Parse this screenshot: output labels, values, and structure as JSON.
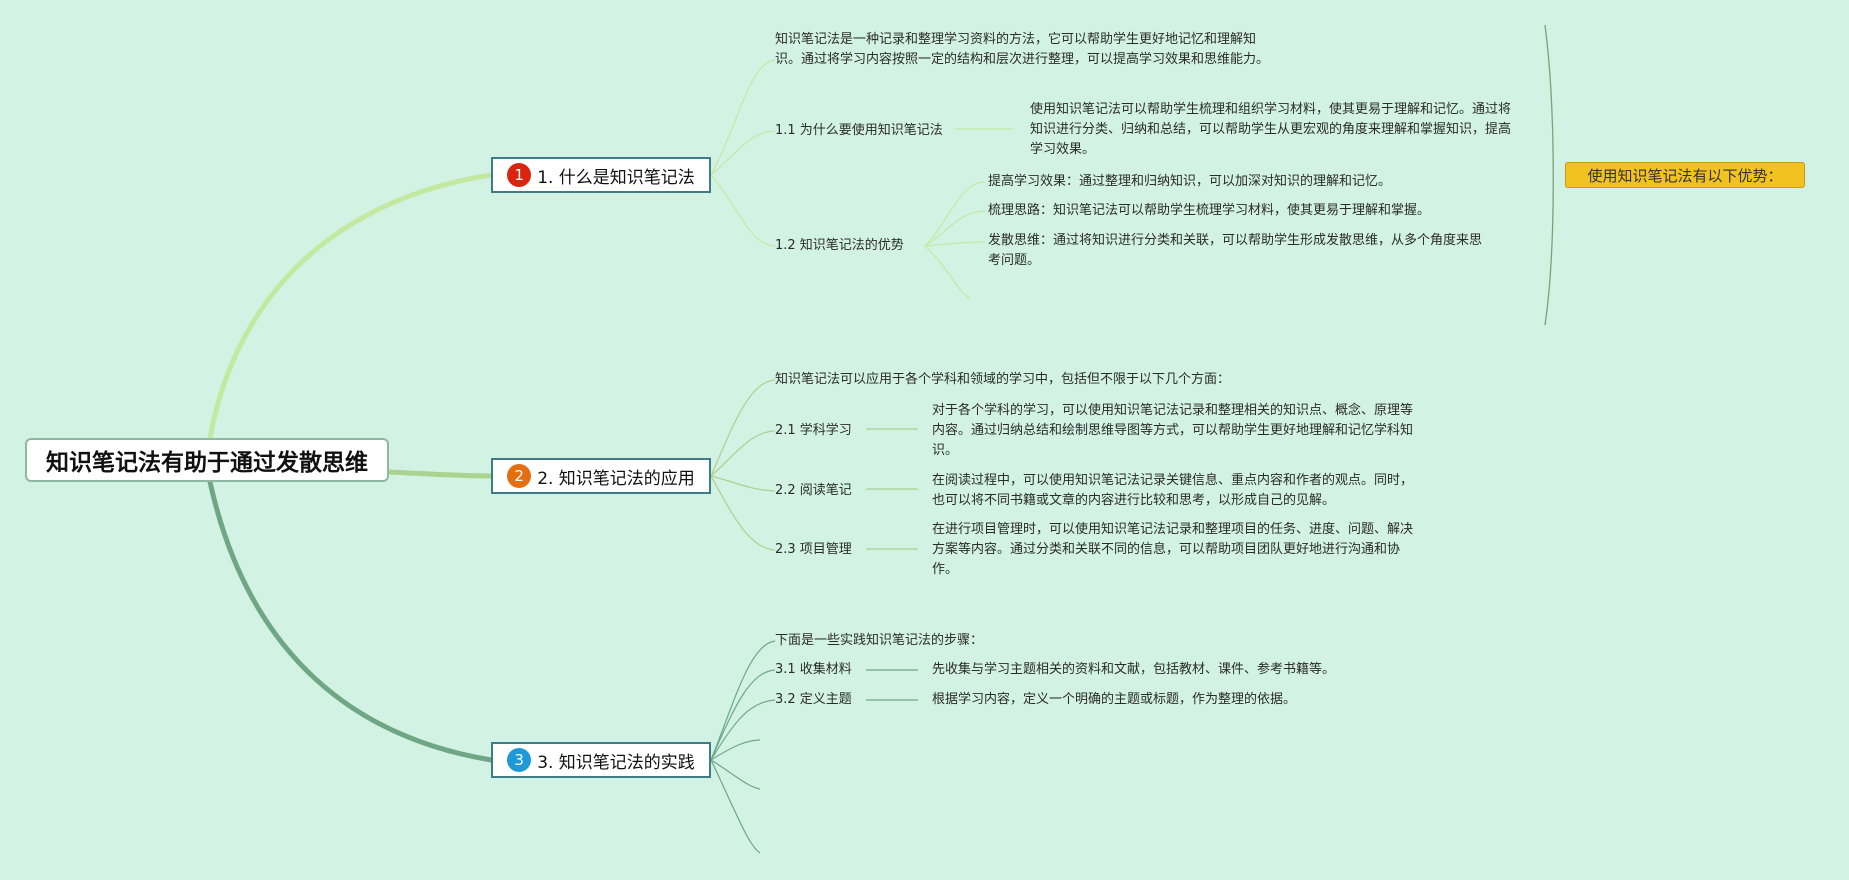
{
  "root": {
    "label": "知识笔记法有助于通过发散思维"
  },
  "colors": {
    "background": "#d2f2e4",
    "branch1": "#c3e9a1",
    "branch2": "#a9d38e",
    "branch3": "#6fa786",
    "badge1": "#d9240f",
    "badge2": "#e46e12",
    "badge3": "#1e9ad9",
    "callout": "#f2c320"
  },
  "sections": [
    {
      "badge": "1",
      "label": "1. 什么是知识笔记法",
      "intro": "知识笔记法是一种记录和整理学习资料的方法，它可以帮助学生更好地记忆和理解知识。通过将学习内容按照一定的结构和层次进行整理，可以提高学习效果和思维能力。",
      "children": [
        {
          "label": "1.1 为什么要使用知识笔记法",
          "detail": "使用知识笔记法可以帮助学生梳理和组织学习材料，使其更易于理解和记忆。通过将知识进行分类、归纳和总结，可以帮助学生从更宏观的角度来理解和掌握知识，提高学习效果。"
        },
        {
          "label": "1.2 知识笔记法的优势",
          "items": [
            "提高学习效果：通过整理和归纳知识，可以加深对知识的理解和记忆。",
            "梳理思路：知识笔记法可以帮助学生梳理学习材料，使其更易于理解和掌握。",
            "发散思维：通过将知识进行分类和关联，可以帮助学生形成发散思维，从多个角度来思考问题。"
          ]
        }
      ]
    },
    {
      "badge": "2",
      "label": "2. 知识笔记法的应用",
      "intro": "知识笔记法可以应用于各个学科和领域的学习中，包括但不限于以下几个方面：",
      "children": [
        {
          "label": "2.1 学科学习",
          "detail": "对于各个学科的学习，可以使用知识笔记法记录和整理相关的知识点、概念、原理等内容。通过归纳总结和绘制思维导图等方式，可以帮助学生更好地理解和记忆学科知识。"
        },
        {
          "label": "2.2 阅读笔记",
          "detail": "在阅读过程中，可以使用知识笔记法记录关键信息、重点内容和作者的观点。同时，也可以将不同书籍或文章的内容进行比较和思考，以形成自己的见解。"
        },
        {
          "label": "2.3 项目管理",
          "detail": "在进行项目管理时，可以使用知识笔记法记录和整理项目的任务、进度、问题、解决方案等内容。通过分类和关联不同的信息，可以帮助项目团队更好地进行沟通和协作。"
        }
      ]
    },
    {
      "badge": "3",
      "label": "3. 知识笔记法的实践",
      "intro": "下面是一些实践知识笔记法的步骤：",
      "children": [
        {
          "label": "3.1 收集材料",
          "detail": "先收集与学习主题相关的资料和文献，包括教材、课件、参考书籍等。"
        },
        {
          "label": "3.2 定义主题",
          "detail": "根据学习内容，定义一个明确的主题或标题，作为整理的依据。"
        }
      ]
    }
  ],
  "callout": {
    "label": "使用知识笔记法有以下优势："
  }
}
